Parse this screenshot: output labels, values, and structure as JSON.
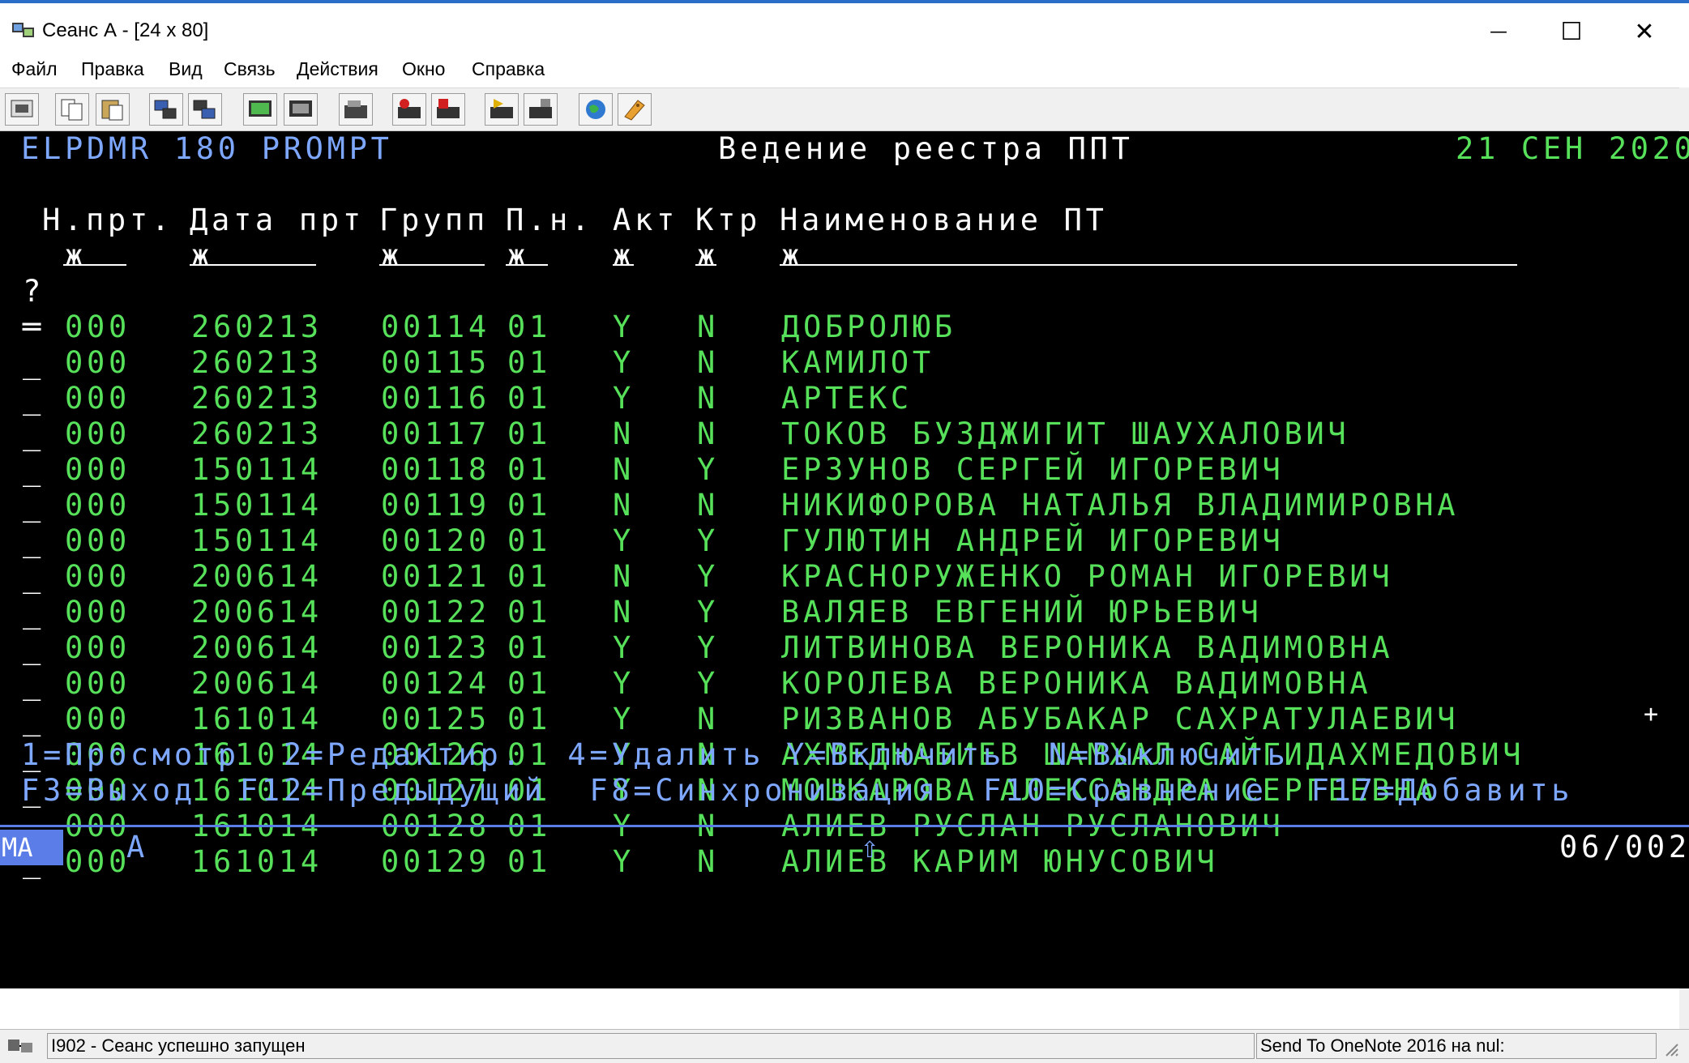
{
  "window": {
    "title": "Сеанс А - [24 x 80]",
    "minimize": "—",
    "maximize": "☐",
    "close": "✕"
  },
  "menu": [
    "Файл",
    "Правка",
    "Вид",
    "Связь",
    "Действия",
    "Окно",
    "Справка"
  ],
  "toolbar": {
    "buttons": [
      "print-screen-icon",
      "copy-icon",
      "paste-icon",
      "send-icon",
      "receive-icon",
      "display-icon",
      "keyboard-map-icon",
      "macro-icon",
      "record-macro-icon",
      "stop-macro-icon",
      "play-macro-icon",
      "transfer-icon",
      "web-icon",
      "settings-icon"
    ]
  },
  "screen": {
    "program": "ELPDMR 180 PROMPT",
    "title": "Ведение реестра ППТ",
    "date": "21 СЕН 2020",
    "headers": [
      "Н.прт.",
      "Дата прт",
      "Групп",
      "П.н.",
      "Акт",
      "Ктр",
      "Наименование ПТ"
    ],
    "filter_mark": "ж",
    "prompt_mark": "?",
    "rows": [
      {
        "sel": "═",
        "prt": "000",
        "date": "260213",
        "group": "00114",
        "pn": "01",
        "act": "Y",
        "ctr": "N",
        "name": "ДОБРОЛЮБ"
      },
      {
        "sel": "_",
        "prt": "000",
        "date": "260213",
        "group": "00115",
        "pn": "01",
        "act": "Y",
        "ctr": "N",
        "name": "КАМИЛОТ"
      },
      {
        "sel": "_",
        "prt": "000",
        "date": "260213",
        "group": "00116",
        "pn": "01",
        "act": "Y",
        "ctr": "N",
        "name": "АРТЕКС"
      },
      {
        "sel": "_",
        "prt": "000",
        "date": "260213",
        "group": "00117",
        "pn": "01",
        "act": "N",
        "ctr": "N",
        "name": "ТОКОВ БУЗДЖИГИТ ШАУХАЛОВИЧ"
      },
      {
        "sel": "_",
        "prt": "000",
        "date": "150114",
        "group": "00118",
        "pn": "01",
        "act": "N",
        "ctr": "Y",
        "name": "ЕРЗУНОВ СЕРГЕЙ ИГОРЕВИЧ"
      },
      {
        "sel": "_",
        "prt": "000",
        "date": "150114",
        "group": "00119",
        "pn": "01",
        "act": "N",
        "ctr": "N",
        "name": "НИКИФОРОВА НАТАЛЬЯ ВЛАДИМИРОВНА"
      },
      {
        "sel": "_",
        "prt": "000",
        "date": "150114",
        "group": "00120",
        "pn": "01",
        "act": "Y",
        "ctr": "Y",
        "name": "ГУЛЮТИН АНДРЕЙ ИГОРЕВИЧ"
      },
      {
        "sel": "_",
        "prt": "000",
        "date": "200614",
        "group": "00121",
        "pn": "01",
        "act": "N",
        "ctr": "Y",
        "name": "КРАСНОРУЖЕНКО РОМАН ИГОРЕВИЧ"
      },
      {
        "sel": "_",
        "prt": "000",
        "date": "200614",
        "group": "00122",
        "pn": "01",
        "act": "N",
        "ctr": "Y",
        "name": "ВАЛЯЕВ ЕВГЕНИЙ ЮРЬЕВИЧ"
      },
      {
        "sel": "_",
        "prt": "000",
        "date": "200614",
        "group": "00123",
        "pn": "01",
        "act": "Y",
        "ctr": "Y",
        "name": "ЛИТВИНОВА ВЕРОНИКА ВАДИМОВНА"
      },
      {
        "sel": "_",
        "prt": "000",
        "date": "200614",
        "group": "00124",
        "pn": "01",
        "act": "Y",
        "ctr": "Y",
        "name": "КОРОЛЕВА ВЕРОНИКА ВАДИМОВНА"
      },
      {
        "sel": "_",
        "prt": "000",
        "date": "161014",
        "group": "00125",
        "pn": "01",
        "act": "Y",
        "ctr": "N",
        "name": "РИЗВАНОВ АБУБАКАР САХРАТУЛАЕВИЧ"
      },
      {
        "sel": "_",
        "prt": "000",
        "date": "161014",
        "group": "00126",
        "pn": "01",
        "act": "Y",
        "ctr": "N",
        "name": "АХМЕДНАБИЕВ ШАМХАЛ САЙГИДАХМЕДОВИЧ"
      },
      {
        "sel": "_",
        "prt": "000",
        "date": "161014",
        "group": "00127",
        "pn": "01",
        "act": "Y",
        "ctr": "N",
        "name": "МОШКАРОВА АЛЕКСАНДРА СЕРГЕЕВНА"
      },
      {
        "sel": "_",
        "prt": "000",
        "date": "161014",
        "group": "00128",
        "pn": "01",
        "act": "Y",
        "ctr": "N",
        "name": "АЛИЕВ РУСЛАН РУСЛАНОВИЧ"
      },
      {
        "sel": "_",
        "prt": "000",
        "date": "161014",
        "group": "00129",
        "pn": "01",
        "act": "Y",
        "ctr": "N",
        "name": "АЛИЕВ КАРИМ ЮНУСОВИЧ"
      }
    ],
    "more_indicator": "+",
    "options_line": "1=Просмотр  2=Редактир.  4=Удалить Y=Включить  N=Выключить",
    "fkeys_line": "F3=Выход  F12=Предыдущий  F8=Синхронизация  F10=Сравнение  F17=Добавить"
  },
  "oia": {
    "mode": "МА",
    "session": "A",
    "shift": "⇧",
    "cursor_pos": "06/002"
  },
  "statusbar": {
    "message": "I902 - Сеанс успешно запущен",
    "right": "Send To OneNote 2016 на nul:"
  }
}
